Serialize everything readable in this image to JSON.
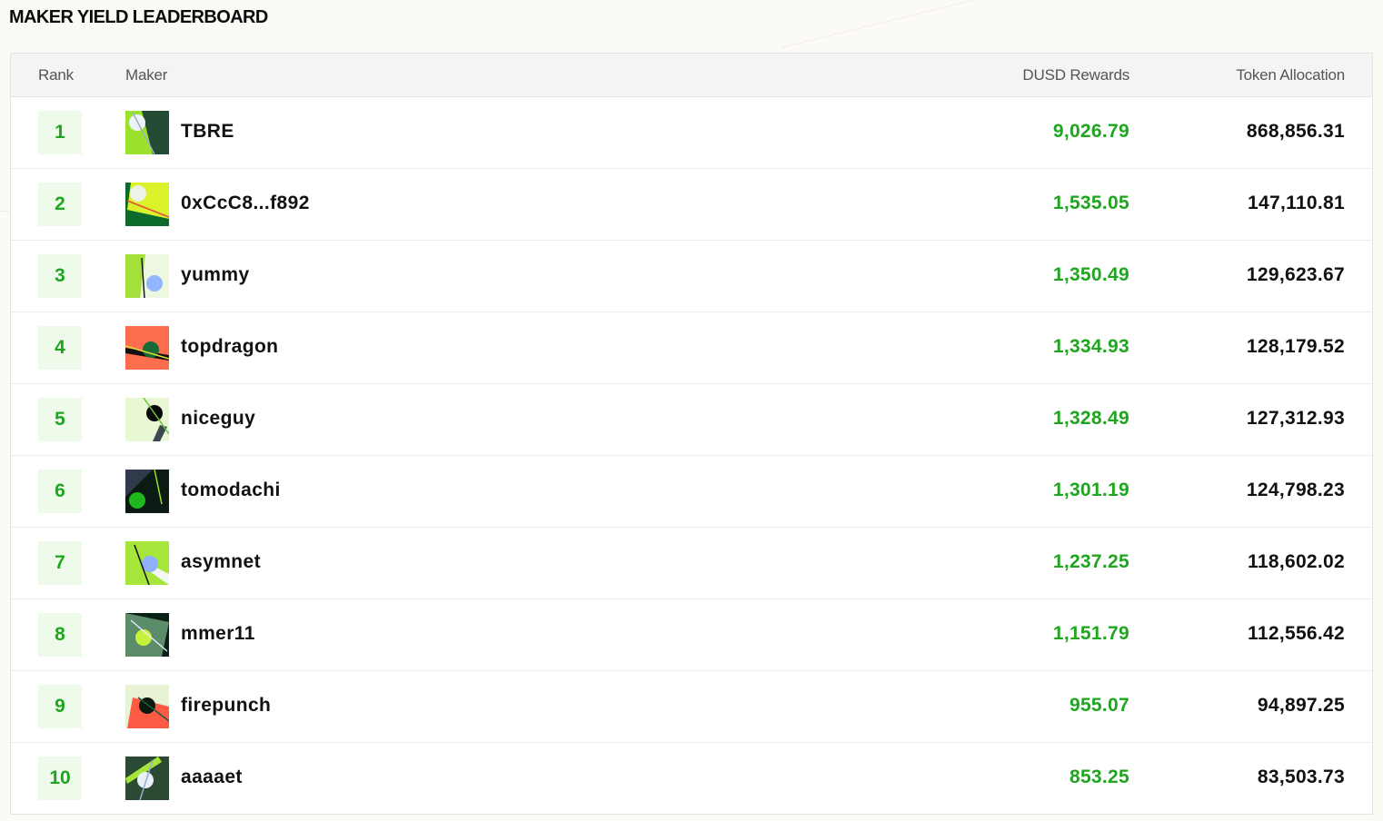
{
  "page": {
    "title": "MAKER YIELD LEADERBOARD"
  },
  "table": {
    "headers": {
      "rank": "Rank",
      "maker": "Maker",
      "dusd": "DUSD Rewards",
      "token": "Token Allocation"
    },
    "rows": [
      {
        "rank": "1",
        "maker": "TBRE",
        "dusd": "9,026.79",
        "token": "868,856.31",
        "avatar_icon": "abstract-avatar-icon"
      },
      {
        "rank": "2",
        "maker": "0xCcC8...f892",
        "dusd": "1,535.05",
        "token": "147,110.81",
        "avatar_icon": "abstract-avatar-icon"
      },
      {
        "rank": "3",
        "maker": "yummy",
        "dusd": "1,350.49",
        "token": "129,623.67",
        "avatar_icon": "abstract-avatar-icon"
      },
      {
        "rank": "4",
        "maker": "topdragon",
        "dusd": "1,334.93",
        "token": "128,179.52",
        "avatar_icon": "abstract-avatar-icon"
      },
      {
        "rank": "5",
        "maker": "niceguy",
        "dusd": "1,328.49",
        "token": "127,312.93",
        "avatar_icon": "abstract-avatar-icon"
      },
      {
        "rank": "6",
        "maker": "tomodachi",
        "dusd": "1,301.19",
        "token": "124,798.23",
        "avatar_icon": "abstract-avatar-icon"
      },
      {
        "rank": "7",
        "maker": "asymnet",
        "dusd": "1,237.25",
        "token": "118,602.02",
        "avatar_icon": "abstract-avatar-icon"
      },
      {
        "rank": "8",
        "maker": "mmer11",
        "dusd": "1,151.79",
        "token": "112,556.42",
        "avatar_icon": "abstract-avatar-icon"
      },
      {
        "rank": "9",
        "maker": "firepunch",
        "dusd": "955.07",
        "token": "94,897.25",
        "avatar_icon": "abstract-avatar-icon"
      },
      {
        "rank": "10",
        "maker": "aaaaet",
        "dusd": "853.25",
        "token": "83,503.73",
        "avatar_icon": "abstract-avatar-icon"
      }
    ]
  },
  "colors": {
    "accent_green": "#1fa51f",
    "rank_bg": "#eefbea",
    "header_bg": "#f4f4f4",
    "page_bg": "#fbfaf5"
  }
}
